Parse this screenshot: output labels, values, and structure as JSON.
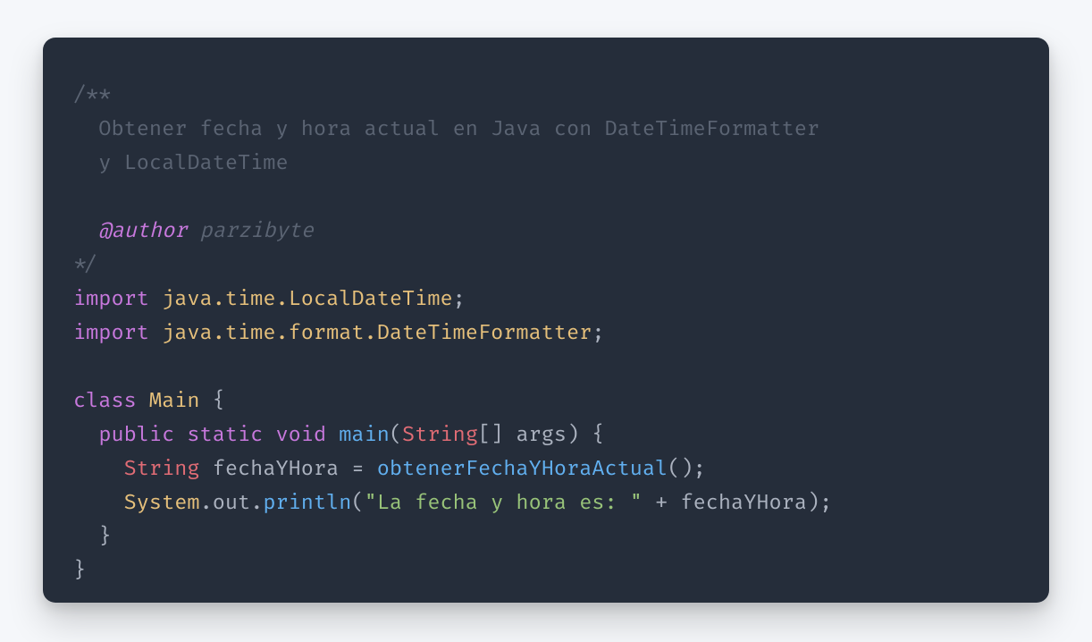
{
  "code": {
    "comment_open": "/**",
    "comment_l1": "  Obtener fecha y hora actual en Java con DateTimeFormatter",
    "comment_l2": "  y LocalDateTime",
    "comment_blank": "",
    "comment_author_tag": "  @author",
    "comment_author_name": " parzibyte",
    "comment_close": "*/",
    "kw_import": "import",
    "import1_pkg": " java.time.",
    "import1_cls": "LocalDateTime",
    "import2_pkg": " java.time.format.",
    "import2_cls": "DateTimeFormatter",
    "semi": ";",
    "kw_class": "class",
    "class_name": " Main ",
    "brace_open": "{",
    "brace_close": "}",
    "indent1": "  ",
    "indent2": "    ",
    "kw_public": "public",
    "kw_static": " static",
    "kw_void": " void",
    "main_name": " main",
    "paren_open": "(",
    "paren_close": ")",
    "string_type": "String",
    "array_brackets": "[] ",
    "args_name": "args",
    "space_brace": " {",
    "var_name": " fechaYHora ",
    "equals": "= ",
    "fn_obtener": "obtenerFechaYHoraActual",
    "empty_call": "()",
    "system": "System",
    "dot": ".",
    "out": "out",
    "println": "println",
    "str_literal": "\"La fecha y hora es: \"",
    "plus": " + ",
    "var_ref": "fechaYHora",
    "close_paren_semi": ");"
  }
}
